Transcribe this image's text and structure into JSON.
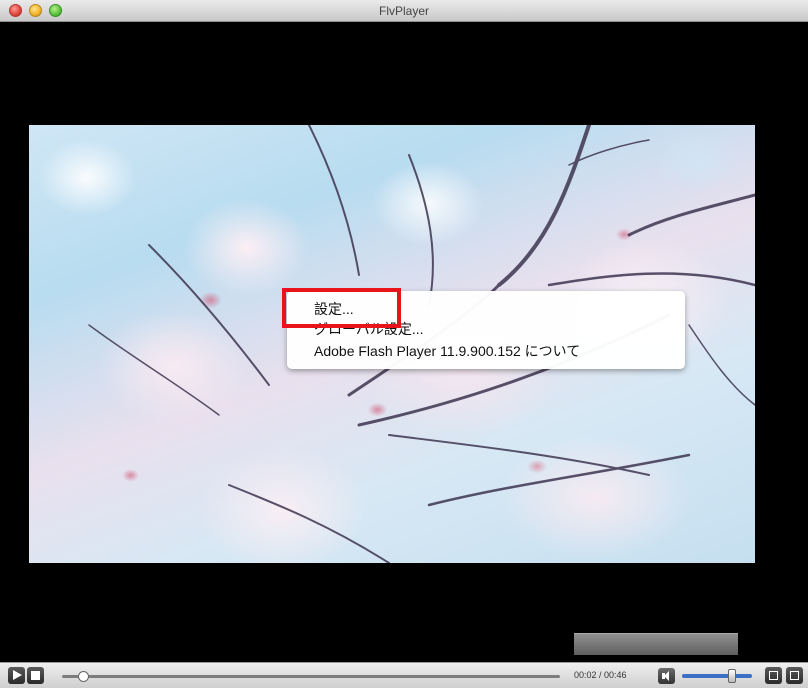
{
  "window": {
    "title": "FlvPlayer"
  },
  "context_menu": {
    "items": [
      {
        "label": "設定..."
      },
      {
        "label": "グローバル設定..."
      },
      {
        "label": "Adobe Flash Player 11.9.900.152 について"
      }
    ]
  },
  "player": {
    "time": "00:02 / 00:46",
    "progress_fraction": 0.04,
    "volume_fraction": 0.72
  },
  "colors": {
    "highlight": "#e8131b",
    "volume_track": "#3a6fc5"
  }
}
